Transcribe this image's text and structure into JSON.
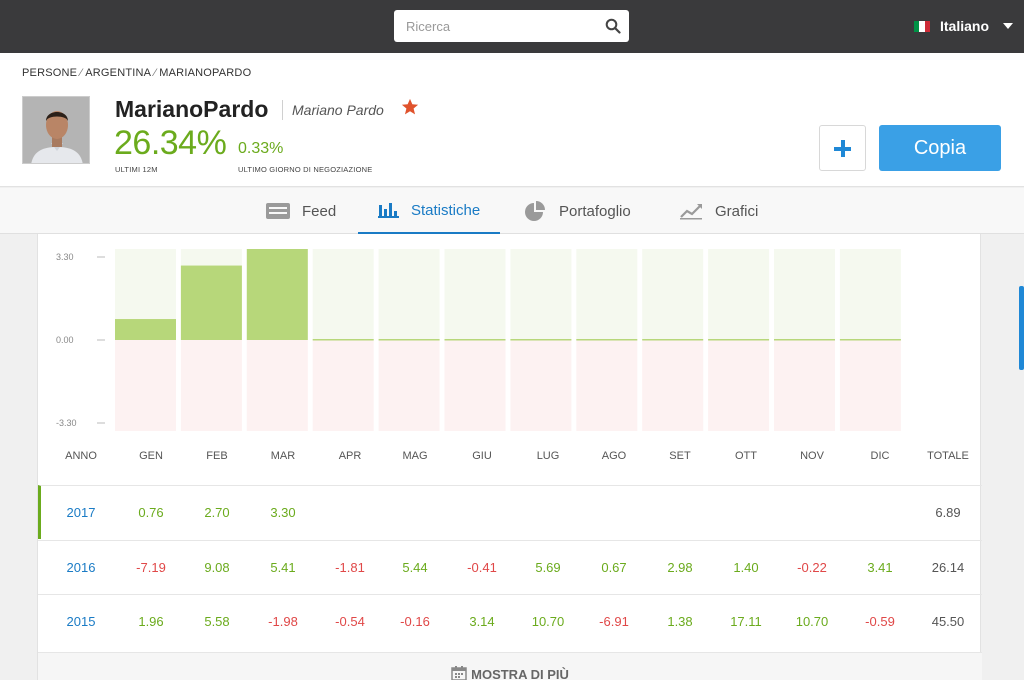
{
  "search": {
    "placeholder": "Ricerca",
    "icon": "search-icon"
  },
  "language": {
    "label": "Italiano",
    "flag_colors": [
      "#009246",
      "#ffffff",
      "#ce2b37"
    ]
  },
  "breadcrumb": [
    "PERSONE",
    "ARGENTINA",
    "MARIANOPARDO"
  ],
  "profile": {
    "username": "MarianoPardo",
    "full_name": "Mariano Pardo",
    "gain": "26.34%",
    "gain_label": "ULTIMI 12M",
    "day_gain": "0.33%",
    "day_gain_label": "ULTIMO GIORNO DI NEGOZIAZIONE"
  },
  "actions": {
    "add_symbol": "+",
    "copy_label": "Copia"
  },
  "tabs": [
    {
      "label": "Feed",
      "icon": "feed-icon",
      "active": false
    },
    {
      "label": "Statistiche",
      "icon": "bar-chart-icon",
      "active": true
    },
    {
      "label": "Portafoglio",
      "icon": "pie-chart-icon",
      "active": false
    },
    {
      "label": "Grafici",
      "icon": "line-chart-icon",
      "active": false
    }
  ],
  "chart_data": {
    "type": "bar",
    "categories": [
      "GEN",
      "FEB",
      "MAR",
      "APR",
      "MAG",
      "GIU",
      "LUG",
      "AGO",
      "SET",
      "OTT",
      "NOV",
      "DIC"
    ],
    "values": [
      0.76,
      2.7,
      3.3,
      null,
      null,
      null,
      null,
      null,
      null,
      null,
      null,
      null
    ],
    "y_ticks": [
      "3.30",
      "0.00",
      "-3.30"
    ],
    "ylim": [
      -3.3,
      3.3
    ],
    "colors": {
      "positive": "#b7d77a",
      "positive_bg": "#f5f9ef",
      "negative_bg": "#fdf2f2"
    }
  },
  "table": {
    "columns": [
      "ANNO",
      "GEN",
      "FEB",
      "MAR",
      "APR",
      "MAG",
      "GIU",
      "LUG",
      "AGO",
      "SET",
      "OTT",
      "NOV",
      "DIC",
      "TOTALE"
    ],
    "rows": [
      {
        "year": "2017",
        "values": [
          "0.76",
          "2.70",
          "3.30",
          "",
          "",
          "",
          "",
          "",
          "",
          "",
          "",
          ""
        ],
        "total": "6.89"
      },
      {
        "year": "2016",
        "values": [
          "-7.19",
          "9.08",
          "5.41",
          "-1.81",
          "5.44",
          "-0.41",
          "5.69",
          "0.67",
          "2.98",
          "1.40",
          "-0.22",
          "3.41"
        ],
        "total": "26.14"
      },
      {
        "year": "2015",
        "values": [
          "1.96",
          "5.58",
          "-1.98",
          "-0.54",
          "-0.16",
          "3.14",
          "10.70",
          "-6.91",
          "1.38",
          "17.11",
          "10.70",
          "-0.59"
        ],
        "total": "45.50"
      }
    ]
  },
  "show_more": {
    "label": "MOSTRA DI PIÙ",
    "icon": "calendar-icon"
  }
}
